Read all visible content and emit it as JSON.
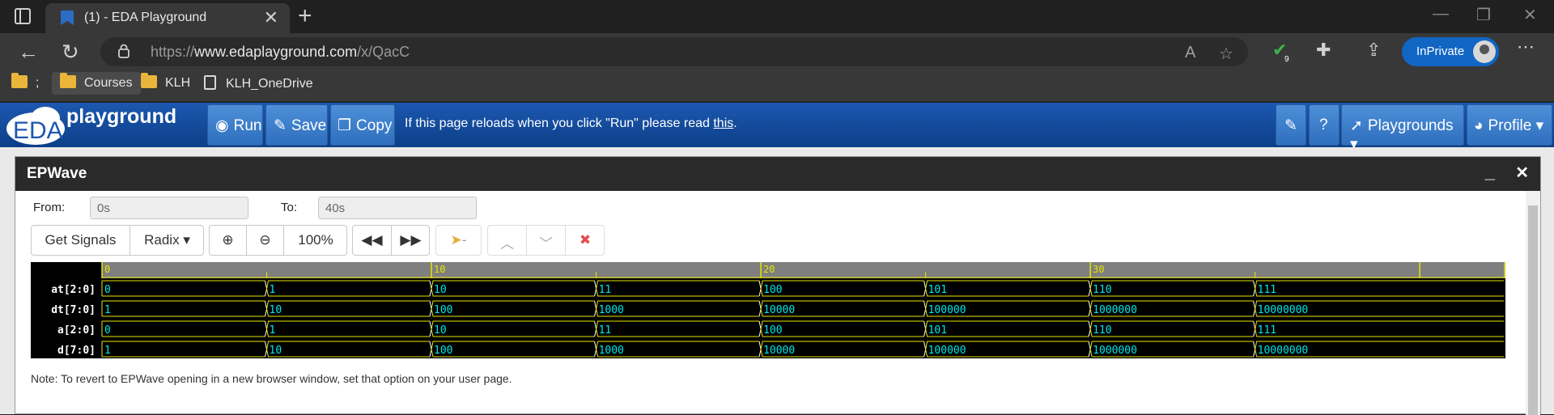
{
  "browser": {
    "tab_title": "(1) - EDA Playground",
    "url_prefix": "https://",
    "url_host": "www.edaplayground.com",
    "url_path": "/x/QacC",
    "extension_badge": "9",
    "inprivate_label": "InPrivate",
    "bookmarks": [
      {
        "label": ";",
        "icon": "folder-icon"
      },
      {
        "label": "Courses",
        "icon": "folder-icon"
      },
      {
        "label": "KLH",
        "icon": "folder-icon"
      },
      {
        "label": "KLH_OneDrive",
        "icon": "page-icon"
      }
    ]
  },
  "eda": {
    "logo_text": "EDA",
    "logo_sub": "playground",
    "run_label": "Run",
    "save_label": "Save",
    "copy_label": "Copy",
    "notice_text": "If this page reloads when you click \"Run\" please read ",
    "notice_link": "this",
    "notice_end": ".",
    "playgrounds_label": "Playgrounds",
    "profile_label": "Profile",
    "colors": {
      "header": "#0d3f88",
      "button": "#3a7cc9"
    }
  },
  "epwave": {
    "title": "EPWave",
    "from_label": "From:",
    "from_value": "0s",
    "to_label": "To:",
    "to_value": "40s",
    "get_signals": "Get Signals",
    "radix": "Radix",
    "zoom": "100%",
    "marker_dash": "-",
    "note": "Note: To revert to EPWave opening in a new browser window, set that option on your user page.",
    "timeline": {
      "ticks": [
        "0",
        "10",
        "20",
        "30"
      ],
      "start": 0,
      "end": 42.6,
      "transitions": [
        0,
        5,
        10,
        15,
        20,
        25,
        30,
        35
      ]
    },
    "signals": [
      {
        "name": "at[2:0]",
        "values": [
          "0",
          "1",
          "10",
          "11",
          "100",
          "101",
          "110",
          "111"
        ]
      },
      {
        "name": "dt[7:0]",
        "values": [
          "1",
          "10",
          "100",
          "1000",
          "10000",
          "100000",
          "1000000",
          "10000000"
        ]
      },
      {
        "name": "a[2:0]",
        "values": [
          "0",
          "1",
          "10",
          "11",
          "100",
          "101",
          "110",
          "111"
        ]
      },
      {
        "name": "d[7:0]",
        "values": [
          "1",
          "10",
          "100",
          "1000",
          "10000",
          "100000",
          "1000000",
          "10000000"
        ]
      }
    ],
    "colors": {
      "value_text": "#00e5e5",
      "trace": "#e5e500",
      "axis": "#7f7f7f",
      "bg": "#000000"
    }
  }
}
